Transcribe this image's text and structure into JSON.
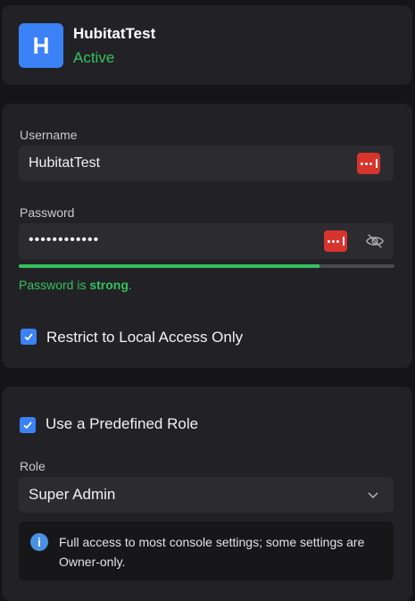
{
  "user": {
    "avatar_letter": "H",
    "name": "HubitatTest",
    "status": "Active"
  },
  "credentials": {
    "username_label": "Username",
    "username_value": "HubitatTest",
    "password_label": "Password",
    "password_value": "••••••••••••",
    "strength": 0.8,
    "strength_prefix": "Password is ",
    "strength_word": "strong",
    "strength_suffix": ".",
    "restrict_label": "Restrict to Local Access Only",
    "restrict_checked": true
  },
  "role": {
    "predefined_label": "Use a Predefined Role",
    "predefined_checked": true,
    "role_label": "Role",
    "role_value": "Super Admin",
    "info_text": "Full access to most console settings; some settings are Owner-only."
  },
  "colors": {
    "accent": "#3b82f6",
    "success": "#34c15e",
    "password_manager": "#d6342d"
  },
  "icons": {
    "password_manager": "password-manager-icon",
    "eye": "eye-slash-icon",
    "check": "check-icon",
    "chevron": "chevron-down-icon",
    "info": "info-icon"
  }
}
